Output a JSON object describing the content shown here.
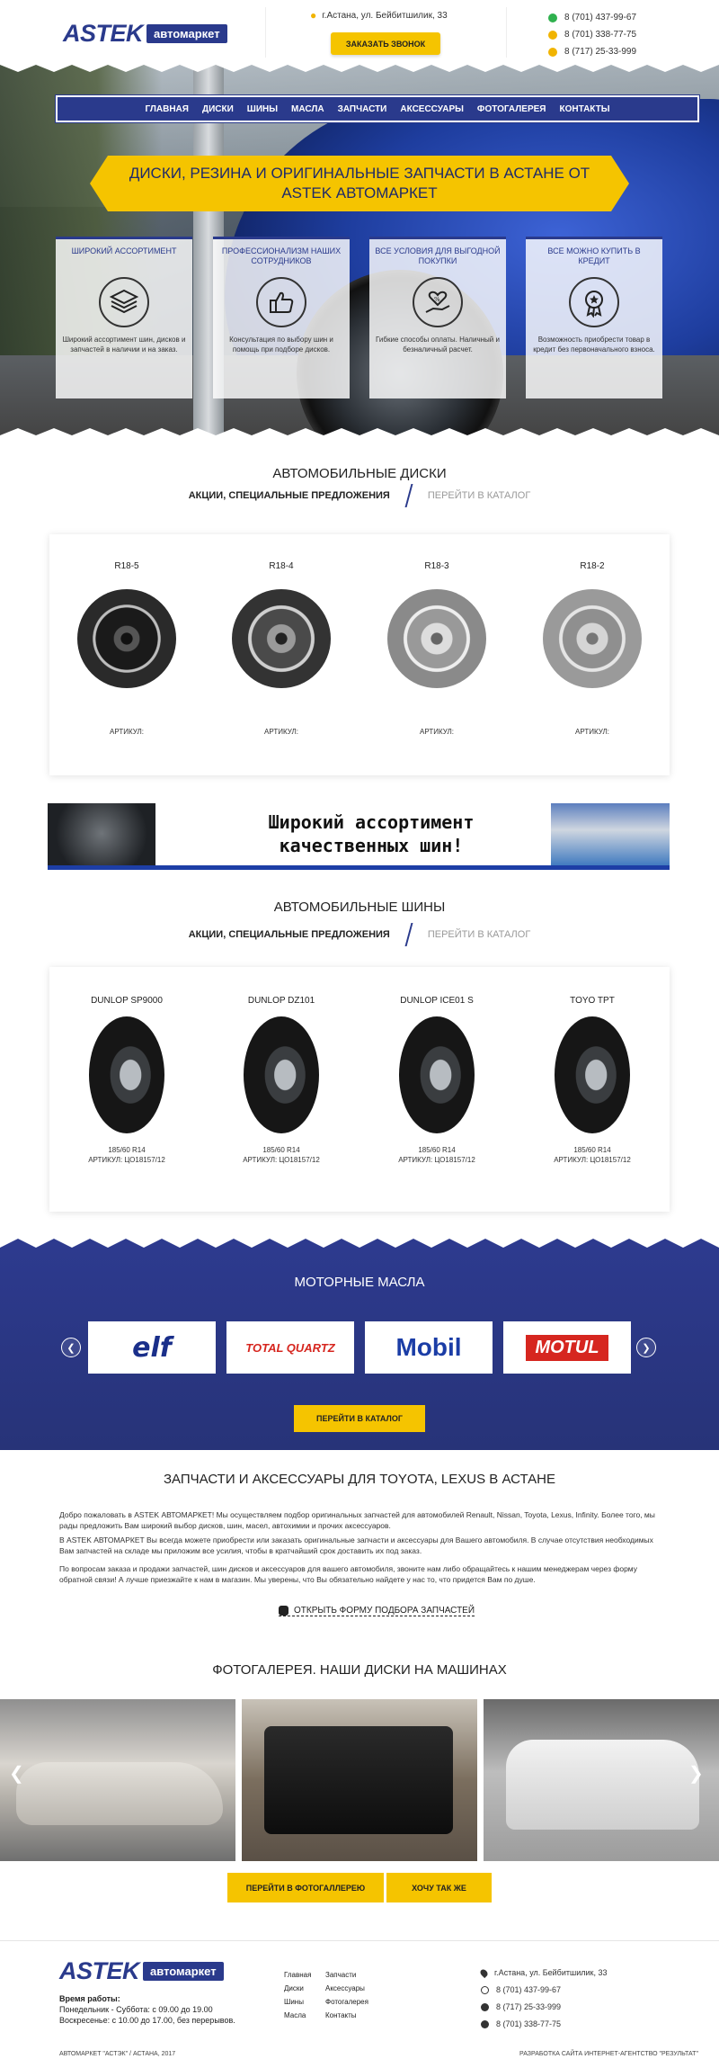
{
  "header": {
    "logo_word": "ASTEK",
    "logo_tag": "автомаркет",
    "address": "г.Астана, ул. Бейбитшилик, 33",
    "call_button": "ЗАКАЗАТЬ ЗВОНОК",
    "phones": [
      "8 (701) 437-99-67",
      "8 (701) 338-77-75",
      "8 (717) 25-33-999"
    ]
  },
  "nav": [
    "ГЛАВНАЯ",
    "ДИСКИ",
    "ШИНЫ",
    "МАСЛА",
    "ЗАПЧАСТИ",
    "АКСЕССУАРЫ",
    "ФОТОГАЛЕРЕЯ",
    "КОНТАКТЫ"
  ],
  "hero": {
    "banner": "ДИСКИ, РЕЗИНА И ОРИГИНАЛЬНЫЕ ЗАПЧАСТИ В АСТАНЕ ОТ ASTEK АВТОМАРКЕТ",
    "features": [
      {
        "title": "ШИРОКИЙ АССОРТИМЕНТ",
        "text": "Широкий ассортимент шин, дисков и запчастей в наличии и на заказ.",
        "icon": "stack-icon"
      },
      {
        "title": "ПРОФЕССИОНАЛИЗМ НАШИХ СОТРУДНИКОВ",
        "text": "Консультация по выбору шин и помощь при подборе дисков.",
        "icon": "thumbs-up-icon"
      },
      {
        "title": "ВСЕ УСЛОВИЯ ДЛЯ ВЫГОДНОЙ ПОКУПКИ",
        "text": "Гибкие способы оплаты. Наличный и безналичный расчет.",
        "icon": "heart-hand-icon"
      },
      {
        "title": "ВСЕ МОЖНО КУПИТЬ В КРЕДИТ",
        "text": "Возможность приобрести товар в кредит без первоначального взноса.",
        "icon": "award-icon"
      }
    ]
  },
  "disks": {
    "title": "АВТОМОБИЛЬНЫЕ ДИСКИ",
    "tab_active": "АКЦИИ, СПЕЦИАЛЬНЫЕ ПРЕДЛОЖЕНИЯ",
    "tab_link": "ПЕРЕЙТИ В КАТАЛОГ",
    "items": [
      {
        "name": "R18-5",
        "art": "АРТИКУЛ:"
      },
      {
        "name": "R18-4",
        "art": "АРТИКУЛ:"
      },
      {
        "name": "R18-3",
        "art": "АРТИКУЛ:"
      },
      {
        "name": "R18-2",
        "art": "АРТИКУЛ:"
      }
    ]
  },
  "promo": {
    "line1": "Широкий ассортимент",
    "line2": "качественных  шин!"
  },
  "tires": {
    "title": "АВТОМОБИЛЬНЫЕ ШИНЫ",
    "tab_active": "АКЦИИ, СПЕЦИАЛЬНЫЕ ПРЕДЛОЖЕНИЯ",
    "tab_link": "ПЕРЕЙТИ В КАТАЛОГ",
    "items": [
      {
        "name": "DUNLOP SP9000",
        "size": "185/60 R14",
        "art": "АРТИКУЛ: ЦО18157/12"
      },
      {
        "name": "DUNLOP DZ101",
        "size": "185/60 R14",
        "art": "АРТИКУЛ: ЦО18157/12"
      },
      {
        "name": "DUNLOP ICE01 S",
        "size": "185/60 R14",
        "art": "АРТИКУЛ: ЦО18157/12"
      },
      {
        "name": "TOYO TPT",
        "size": "185/60 R14",
        "art": "АРТИКУЛ: ЦО18157/12"
      }
    ]
  },
  "oils": {
    "title": "МОТОРНЫЕ МАСЛА",
    "brands": [
      "elf",
      "TOTAL QUARTZ",
      "Mobil",
      "MOTUL"
    ],
    "button": "ПЕРЕЙТИ В КАТАЛОГ"
  },
  "parts": {
    "title": "ЗАПЧАСТИ И АКСЕССУАРЫ ДЛЯ TOYOTA, LEXUS В АСТАНЕ",
    "p1": "Добро пожаловать в ASTEK АВТОМАРКЕТ! Мы осуществляем подбор оригинальных запчастей для автомобилей Renault, Nissan, Toyota, Lexus, Infinity. Более того, мы рады предложить Вам широкий выбор дисков, шин, масел, автохимии и прочих аксессуаров.",
    "p2": "В ASTEK АВТОМАРКЕТ Вы всегда можете приобрести или заказать оригинальные запчасти и аксессуары для Вашего автомобиля. В случае отсутствия необходимых Вам запчастей на складе мы приложим все усилия, чтобы в кратчайший срок доставить их под заказ.",
    "p3": "По вопросам заказа и продажи запчастей, шин дисков и аксессуаров для вашего автомобиля, звоните нам либо обращайтесь к нашим менеджерам через форму обратной связи! А лучше приезжайте к нам в магазин. Мы уверены, что Вы обязательно найдете у нас то, что придется Вам по душе.",
    "form_link": "ОТКРЫТЬ ФОРМУ ПОДБОРА ЗАПЧАСТЕЙ"
  },
  "gallery": {
    "title": "ФОТОГАЛЕРЕЯ. НАШИ ДИСКИ НА МАШИНАХ",
    "button_gallery": "ПЕРЕЙТИ В ФОТОГАЛЛЕРЕЮ",
    "button_want": "ХОЧУ ТАК ЖЕ"
  },
  "footer": {
    "hours_title": "Время работы:",
    "hours_1": "Понедельник - Суббота: с 09.00 до 19.00",
    "hours_2": "Воскресенье: с 10.00 до 17.00, без перерывов.",
    "menu_col1": [
      "Главная",
      "Диски",
      "Шины",
      "Масла"
    ],
    "menu_col2": [
      "Запчасти",
      "Аксессуары",
      "Фотогалерея",
      "Контакты"
    ],
    "address": "г.Астана, ул. Бейбитшилик, 33",
    "phones": [
      "8 (701) 437-99-67",
      "8 (717) 25-33-999",
      "8 (701) 338-77-75"
    ],
    "copyright": "АВТОМАРКЕТ \"АСТЭК\" / АСТАНА, 2017",
    "developer": "РАЗРАБОТКА САЙТА ИНТЕРНЕТ-АГЕНТСТВО \"РЕЗУЛЬТАТ\""
  },
  "colors": {
    "brand_blue": "#2a3a8c",
    "accent_yellow": "#f5c400"
  }
}
